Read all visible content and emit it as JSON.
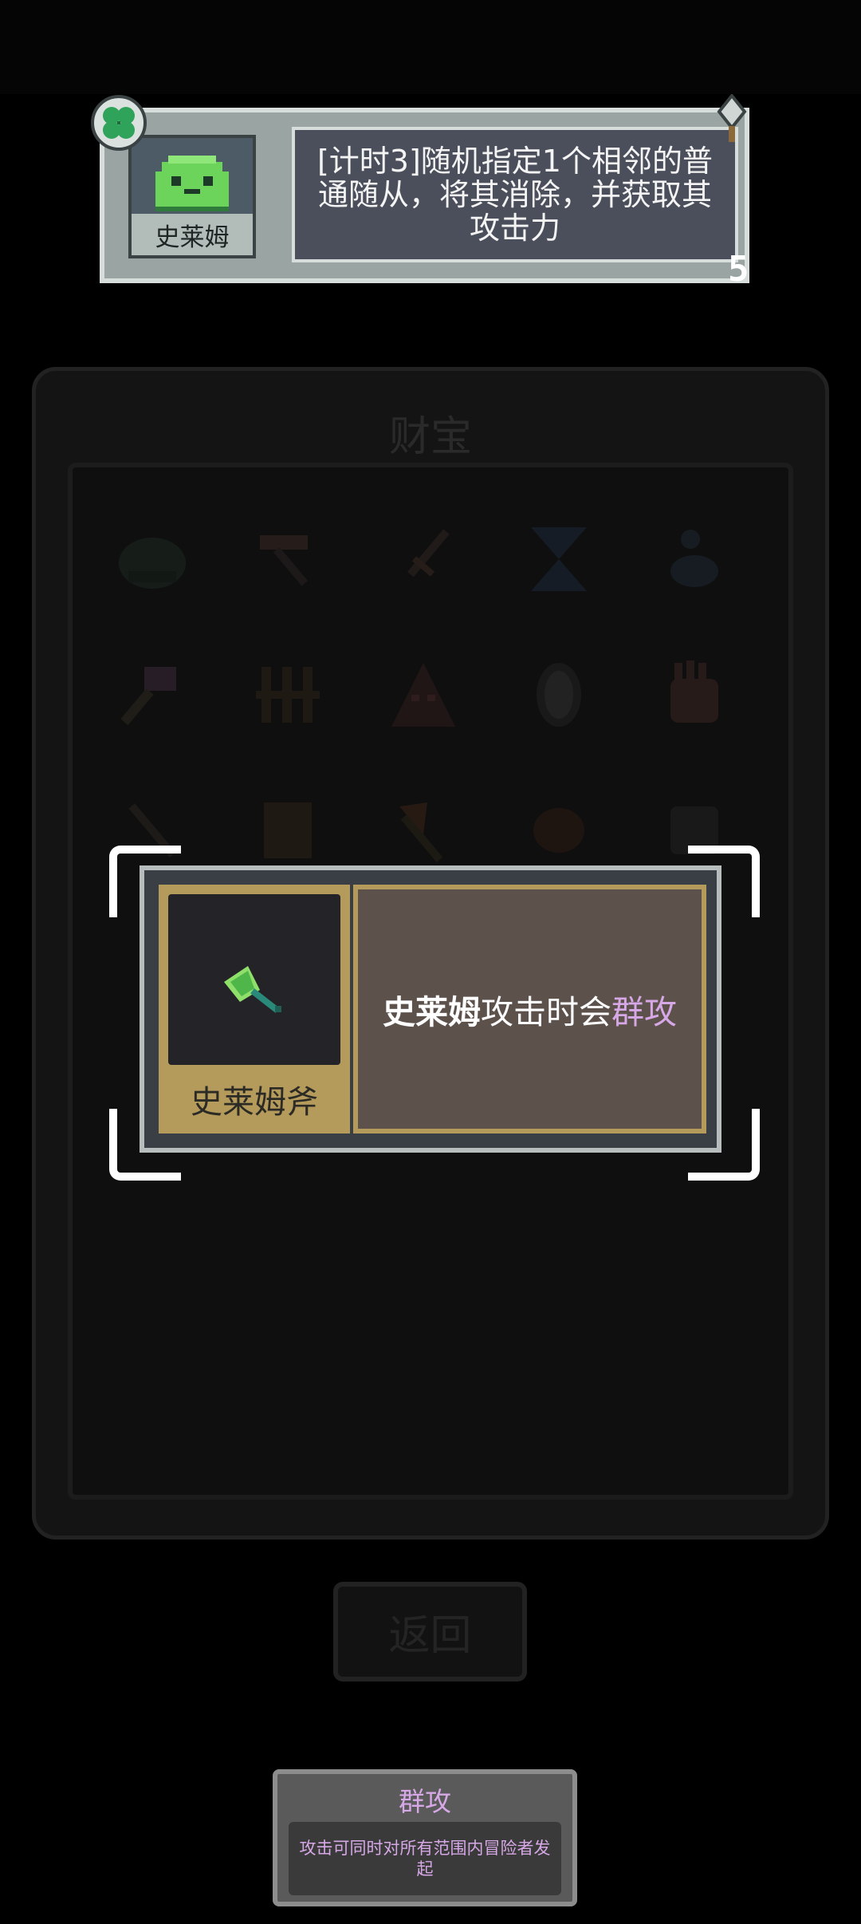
{
  "top_card": {
    "unit_name": "史莱姆",
    "description": "[计时3]随机指定1个相邻的普通随从，将其消除，并获取其攻击力",
    "level": "5",
    "icons": [
      "clover-icon",
      "slime-icon",
      "sword-icon"
    ]
  },
  "treasure": {
    "title": "财宝",
    "item_icons": [
      "helmet-icon",
      "pickaxe-icon",
      "dagger-icon",
      "hourglass-icon",
      "swan-icon",
      "key-icon",
      "fence-icon",
      "hood-icon",
      "mirror-icon",
      "hand-icon",
      "spear-icon",
      "scroll-icon",
      "axe-icon",
      "bird-icon",
      "fist-icon"
    ]
  },
  "return_button": {
    "label": "返回"
  },
  "item_popup": {
    "item_name": "史莱姆斧",
    "desc_subject": "史莱姆",
    "desc_middle": "攻击时会",
    "desc_keyword": "群攻",
    "icon": "slime-axe-icon"
  },
  "tooltip": {
    "title": "群攻",
    "body": "攻击可同时对所有范围内冒险者发起"
  },
  "colors": {
    "keyword": "#d6a8e6",
    "item_frame": "#b49a5b",
    "slime_green": "#6cd45a"
  }
}
